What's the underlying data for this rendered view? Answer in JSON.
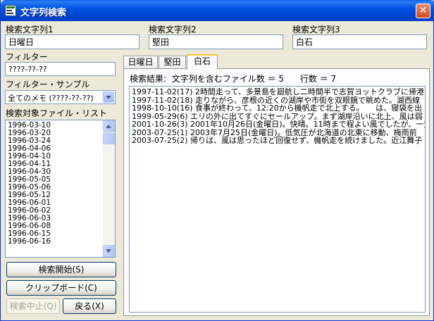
{
  "window": {
    "title": "文字列検索",
    "close_glyph": "✕"
  },
  "fields": [
    {
      "label": "検索文字列1",
      "value": "日曜日"
    },
    {
      "label": "検索文字列2",
      "value": "堅田"
    },
    {
      "label": "検索文字列3",
      "value": "白石"
    }
  ],
  "filter": {
    "label": "フィルター",
    "value": "????-??-??"
  },
  "filter_sample": {
    "label": "フィルター・サンプル",
    "selected": "全てのメモ (????-??-??)"
  },
  "file_list": {
    "label": "検索対象ファイル・リスト",
    "items": [
      "1996-03-10",
      "1996-03-20",
      "1996-03-24",
      "1996-04-06",
      "1996-04-10",
      "1996-04-11",
      "1996-04-30",
      "1996-05-05",
      "1996-05-06",
      "1996-05-12",
      "1996-06-01",
      "1996-06-02",
      "1996-06-03",
      "1996-06-08",
      "1996-06-15",
      "1996-06-16"
    ]
  },
  "buttons": {
    "start": "検索開始(S)",
    "clipboard": "クリップボード(C)",
    "stop": "検索中止(Q)",
    "back": "戻る(X)"
  },
  "tabs": [
    {
      "label": "日曜日",
      "active": false
    },
    {
      "label": "堅田",
      "active": false
    },
    {
      "label": "白石",
      "active": true
    }
  ],
  "results": {
    "summary_label": "検索結果:",
    "file_count_label": "文字列を含むファイル数 ＝",
    "file_count": "5",
    "line_count_label": "行数 ＝",
    "line_count": "7",
    "rows": [
      "1997-11-02(17) 2時間走って、多景島を廻航し二時間半で志賀ヨットクラブに帰港",
      "1997-11-02(18) 走りながら、彦根の近くの湖岸や市街を双眼鏡で眺めた。湖西線",
      "1998-10-10(16) 食事が終わって、12:20から機帆走で北上する。　　は、寝袋を出",
      "1999-05-29(6) エリの外に出てすぐにセールアップ。まず湖岸沿いに北上、風は弱",
      "2001-10-26(3) 2001年10月26日(金曜日)。快晴。11時まで程よい風でしたが、一芳",
      "2003-07-25(1) 2003年7月25日(金曜日)。低気圧が北海道の北東に移動、梅雨前",
      "2003-07-25(2) 帰りは、風は思ったほど回復せず、機帆走を続けました。近江舞子"
    ]
  }
}
